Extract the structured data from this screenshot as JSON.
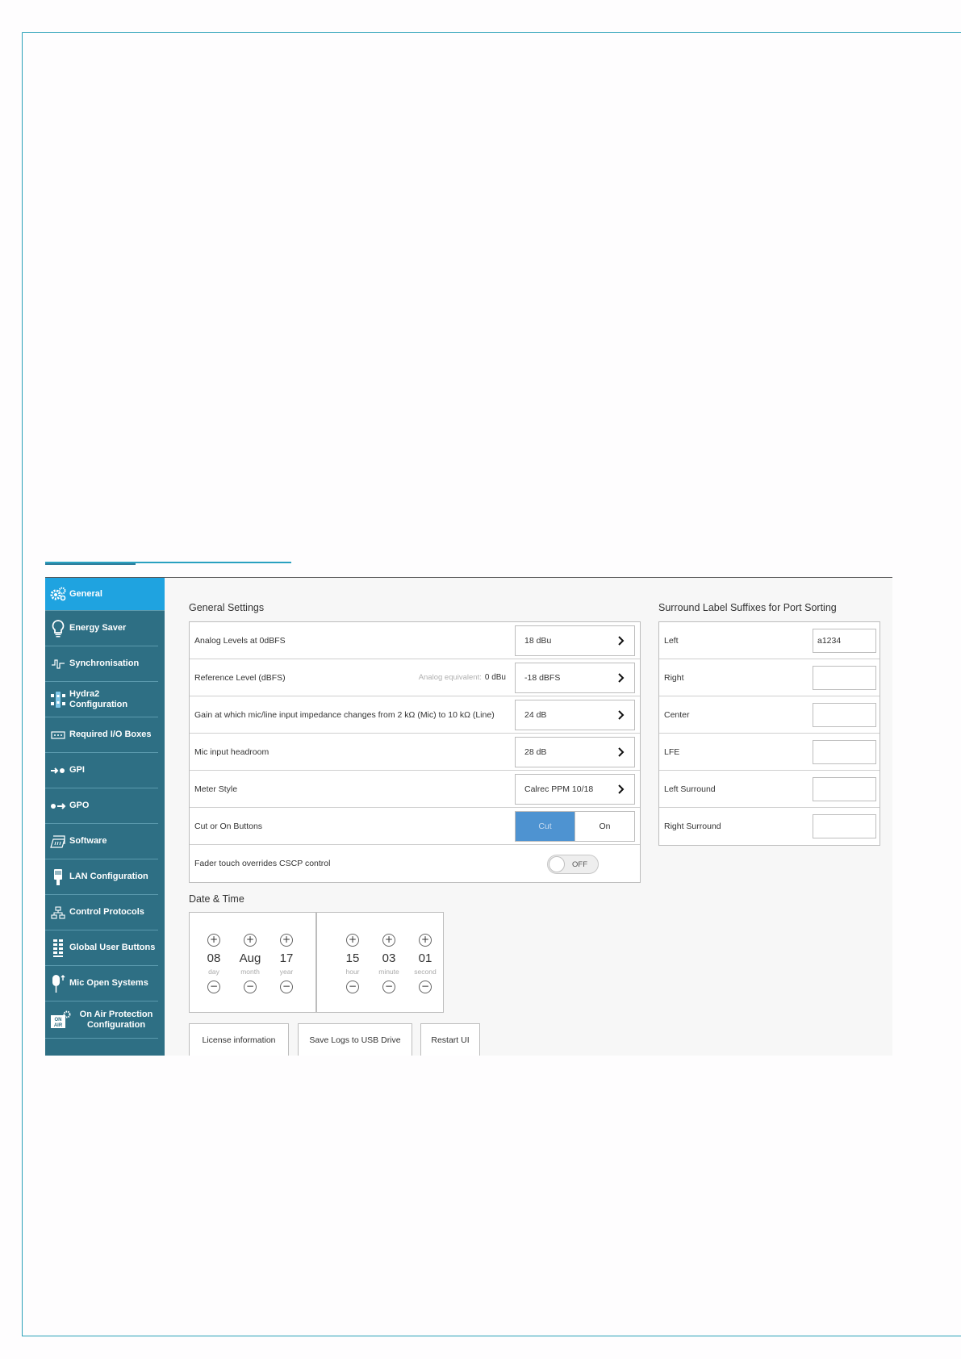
{
  "sidebar": {
    "items": [
      {
        "label": "General",
        "icon": "gears-icon",
        "active": true
      },
      {
        "label": "Energy Saver",
        "icon": "lightbulb-icon"
      },
      {
        "label": "Synchronisation",
        "icon": "sync-signal-icon"
      },
      {
        "label": "Hydra2 Configuration",
        "icon": "hydra-network-icon"
      },
      {
        "label": "Required I/O Boxes",
        "icon": "io-box-icon"
      },
      {
        "label": "GPI",
        "icon": "gpi-arrow-icon"
      },
      {
        "label": "GPO",
        "icon": "gpo-arrow-icon"
      },
      {
        "label": "Software",
        "icon": "software-icon"
      },
      {
        "label": "LAN Configuration",
        "icon": "lan-plug-icon"
      },
      {
        "label": "Control Protocols",
        "icon": "control-protocols-icon"
      },
      {
        "label": "Global User Buttons",
        "icon": "user-buttons-icon"
      },
      {
        "label": "Mic Open Systems",
        "icon": "microphone-icon"
      },
      {
        "label": "On Air Protection Configuration",
        "icon": "on-air-icon"
      }
    ],
    "on_air_badge": "ON AIR"
  },
  "general": {
    "title": "General Settings",
    "rows": [
      {
        "label": "Analog Levels at 0dBFS",
        "value": "18 dBu"
      },
      {
        "label": "Reference Level (dBFS)",
        "hint": "Analog equivalent:",
        "hint_value": "0 dBu",
        "value": "-18 dBFS"
      },
      {
        "label": "Gain at which mic/line input impedance changes from 2 kΩ (Mic) to 10 kΩ (Line)",
        "value": "24 dB"
      },
      {
        "label": "Mic input headroom",
        "value": "28 dB"
      },
      {
        "label": "Meter Style",
        "value": "Calrec PPM 10/18"
      }
    ],
    "cut_on": {
      "label": "Cut or On Buttons",
      "option_cut": "Cut",
      "option_on": "On",
      "selected": "Cut"
    },
    "fader_touch": {
      "label": "Fader touch overrides CSCP control",
      "state": "OFF"
    }
  },
  "surround": {
    "title": "Surround Label Suffixes for Port Sorting",
    "rows": [
      {
        "label": "Left",
        "value": "a1234"
      },
      {
        "label": "Right",
        "value": ""
      },
      {
        "label": "Center",
        "value": ""
      },
      {
        "label": "LFE",
        "value": ""
      },
      {
        "label": "Left Surround",
        "value": ""
      },
      {
        "label": "Right Surround",
        "value": ""
      }
    ]
  },
  "datetime": {
    "title": "Date & Time",
    "date": [
      {
        "value": "08",
        "unit": "day"
      },
      {
        "value": "Aug",
        "unit": "month"
      },
      {
        "value": "17",
        "unit": "year"
      }
    ],
    "time": [
      {
        "value": "15",
        "unit": "hour"
      },
      {
        "value": "03",
        "unit": "minute"
      },
      {
        "value": "01",
        "unit": "second"
      }
    ],
    "plus": "+",
    "minus": "−"
  },
  "buttons": {
    "license": "License information",
    "save_logs": "Save Logs to USB Drive",
    "restart": "Restart UI"
  },
  "colors": {
    "sidebar_bg": "#2e6f84",
    "sidebar_active": "#1fa3e0",
    "accent_blue": "#4e93d1",
    "frame_line": "#2aa1b8"
  }
}
